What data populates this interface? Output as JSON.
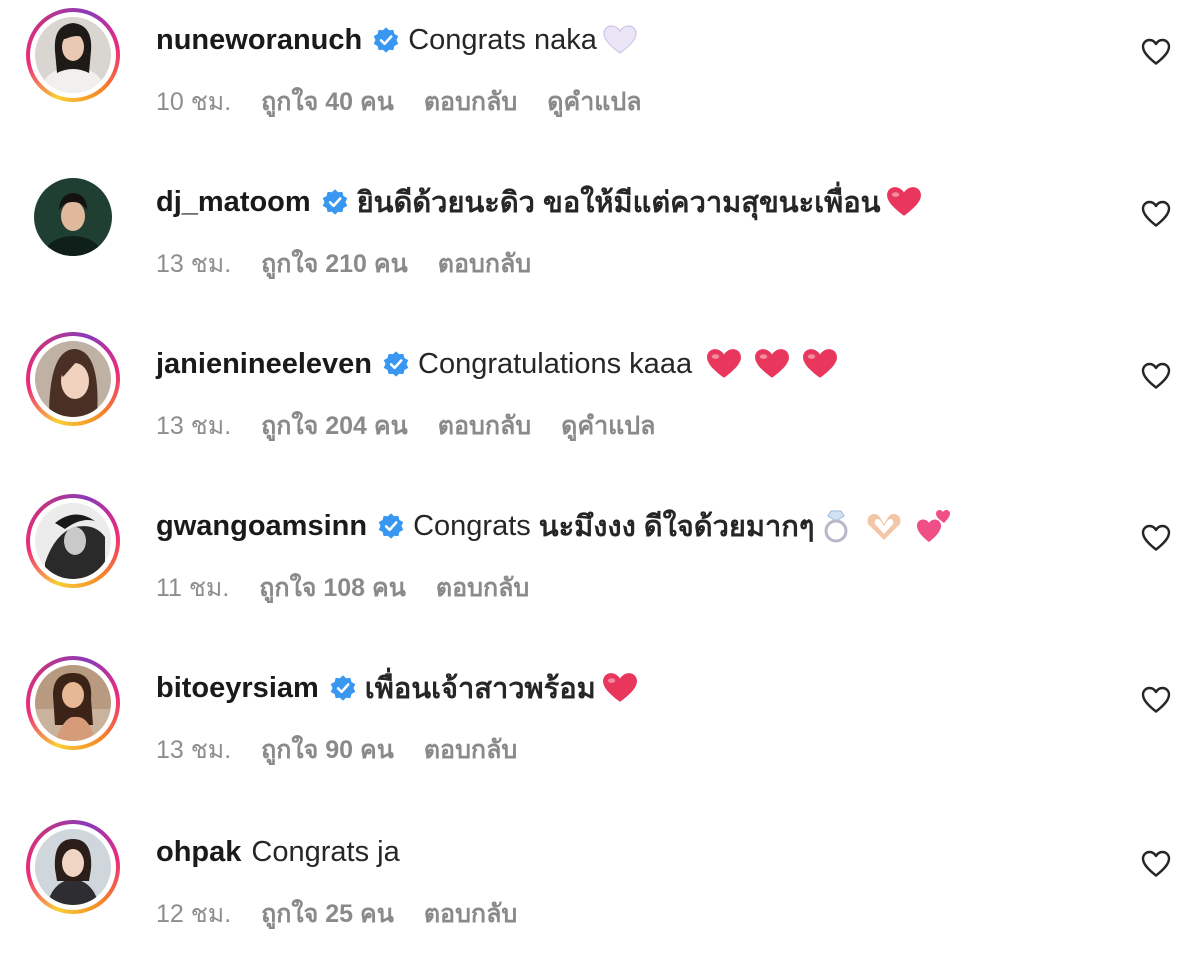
{
  "colors": {
    "verified": "#3897f0",
    "meta_text": "#8e8e8e",
    "username": "#1a1a1a",
    "red_heart": "#e8365d",
    "white_heart": "#e6e0f5"
  },
  "comments": [
    {
      "username": "nuneworanuch",
      "verified": true,
      "text": "Congrats naka",
      "text_bold": false,
      "emojis": [
        "white-heart-icon"
      ],
      "time": "10 ชม.",
      "likes": "ถูกใจ 40 คน",
      "reply": "ตอบกลับ",
      "translate": "ดูคำแปล"
    },
    {
      "username": "dj_matoom",
      "verified": true,
      "text": "ยินดีด้วยนะดิว ขอให้มีแต่ความสุขนะเพื่อน",
      "text_bold": true,
      "emojis": [
        "red-heart-icon"
      ],
      "time": "13 ชม.",
      "likes": "ถูกใจ 210 คน",
      "reply": "ตอบกลับ",
      "translate": ""
    },
    {
      "username": "janienineeleven",
      "verified": true,
      "text": "Congratulations kaaa",
      "text_bold": false,
      "emojis": [
        "red-heart-icon",
        "red-heart-icon",
        "red-heart-icon"
      ],
      "time": "13 ชม.",
      "likes": "ถูกใจ 204 คน",
      "reply": "ตอบกลับ",
      "translate": "ดูคำแปล"
    },
    {
      "username": "gwangoamsinn",
      "verified": true,
      "text": "Congrats",
      "text_bold": false,
      "text2": "นะมึงงง ดีใจด้วยมากๆ",
      "emojis": [
        "ring-icon",
        "heart-hands-icon",
        "two-hearts-icon"
      ],
      "time": "11 ชม.",
      "likes": "ถูกใจ 108 คน",
      "reply": "ตอบกลับ",
      "translate": ""
    },
    {
      "username": "bitoeyrsiam",
      "verified": true,
      "text": "เพื่อนเจ้าสาวพร้อม",
      "text_bold": true,
      "emojis": [
        "red-heart-icon"
      ],
      "time": "13 ชม.",
      "likes": "ถูกใจ 90 คน",
      "reply": "ตอบกลับ",
      "translate": ""
    },
    {
      "username": "ohpak",
      "verified": false,
      "text": "Congrats ja",
      "text_bold": false,
      "emojis": [],
      "time": "12 ชม.",
      "likes": "ถูกใจ 25 คน",
      "reply": "ตอบกลับ",
      "translate": ""
    }
  ]
}
